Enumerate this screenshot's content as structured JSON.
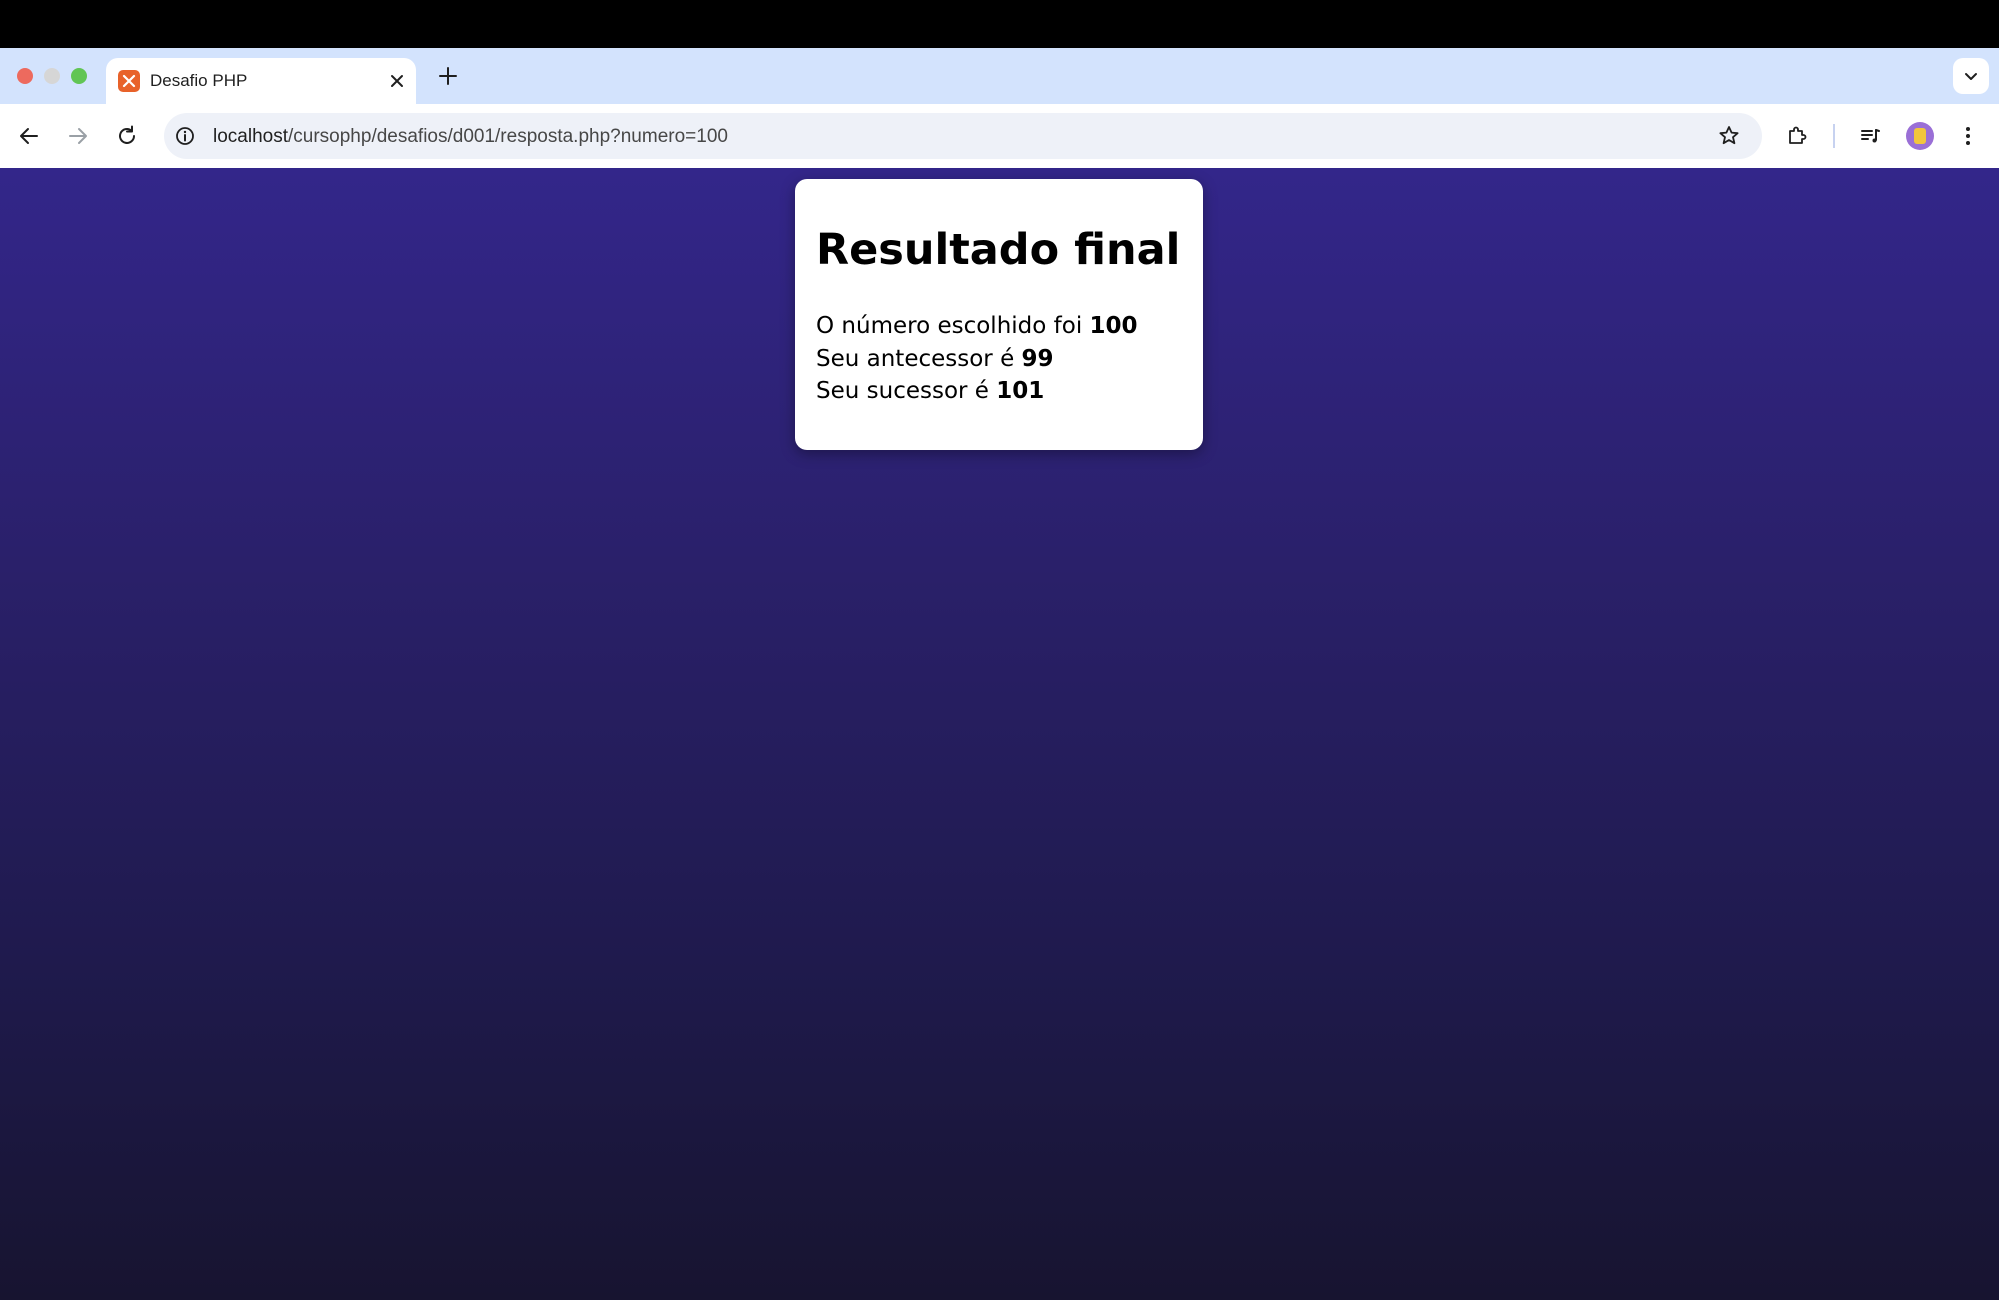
{
  "browser": {
    "tab": {
      "title": "Desafio PHP",
      "favicon": "xampp-favicon-icon"
    },
    "address_bar": {
      "host": "localhost",
      "path": "/cursophp/desafios/d001/resposta.php?numero=100"
    }
  },
  "page": {
    "heading": "Resultado final",
    "lines": [
      {
        "text": "O número escolhido foi ",
        "value": "100"
      },
      {
        "text": "Seu antecessor é ",
        "value": "99"
      },
      {
        "text": "Seu sucessor é ",
        "value": "101"
      }
    ]
  },
  "colors": {
    "tab_strip": "#d3e3fd",
    "page_gradient_top": "#33268a",
    "page_gradient_bottom": "#171430",
    "favicon": "#e8622a",
    "card_background": "#ffffff"
  }
}
